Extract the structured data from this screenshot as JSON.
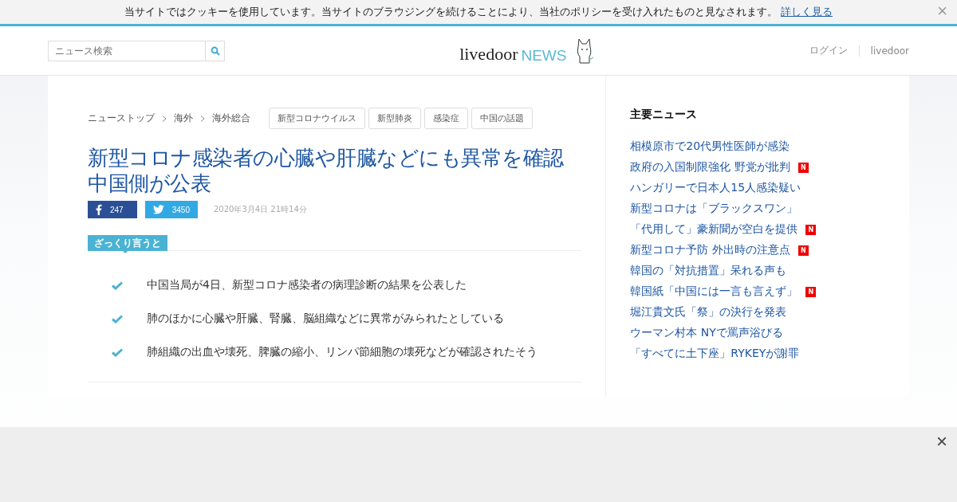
{
  "cookie_bar": {
    "message": "当サイトではクッキーを使用しています。当サイトのブラウジングを続けることにより、当社のポリシーを受け入れたものと見なされます。",
    "link": "詳しく見る",
    "close": "×"
  },
  "header": {
    "search": {
      "placeholder": "ニュース検索"
    },
    "logo": {
      "brand": "livedoor",
      "suffix": "NEWS"
    },
    "links": [
      "ログイン",
      "livedoor"
    ]
  },
  "breadcrumbs": [
    "ニューストップ",
    "海外",
    "海外総合"
  ],
  "tags": [
    "新型コロナウイルス",
    "新型肺炎",
    "感染症",
    "中国の話題"
  ],
  "article": {
    "title": [
      "新型コロナ感染者の心臓や肝臓などにも異常を確認",
      "中国側が公表"
    ],
    "shares": [
      {
        "kind": "facebook",
        "count": "247"
      },
      {
        "kind": "twitter",
        "count": "3450"
      }
    ],
    "date": "2020年3月4日 21時14分",
    "summary_label": "ざっくり言うと",
    "summary": [
      "中国当局が4日、新型コロナ感染者の病理診断の結果を公表した",
      "肺のほかに心臓や肝臓、腎臓、脳組織などに異常がみられたとしている",
      "肺組織の出血や壊死、脾臓の縮小、リンパ節細胞の壊死などが確認されたそう"
    ]
  },
  "sidebar": {
    "title": "主要ニュース",
    "items": [
      {
        "text": "相模原市で20代男性医師が感染"
      },
      {
        "text": "政府の入国制限強化 野党が批判",
        "badge": "N"
      },
      {
        "text": "ハンガリーで日本人15人感染疑い"
      },
      {
        "text": "新型コロナは「ブラックスワン」"
      },
      {
        "text": "「代用して」豪新聞が空白を提供",
        "badge": "N"
      },
      {
        "text": "新型コロナ予防 外出時の注意点",
        "badge": "N"
      },
      {
        "text": "韓国の「対抗措置」呆れる声も"
      },
      {
        "text": "韓国紙「中国には一言も言えず」",
        "badge": "N"
      },
      {
        "text": "堀江貴文氏「祭」の決行を発表"
      },
      {
        "text": "ウーマン村本 NYで罵声浴びる"
      },
      {
        "text": "「すべてに土下座」RYKEYが謝罪"
      }
    ]
  },
  "ad_overlay": {
    "close": "×"
  }
}
